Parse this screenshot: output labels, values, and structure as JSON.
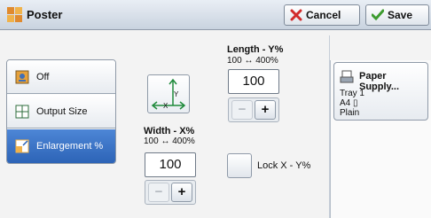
{
  "header": {
    "title": "Poster",
    "cancel_label": "Cancel",
    "save_label": "Save"
  },
  "options": {
    "items": [
      {
        "label": "Off",
        "icon": "off-icon"
      },
      {
        "label": "Output Size",
        "icon": "output-size-icon"
      },
      {
        "label": "Enlargement %",
        "icon": "enlargement-icon"
      }
    ],
    "selected": "Enlargement %"
  },
  "length": {
    "label": "Length - Y%",
    "range": "100 ↔ 400%",
    "value": "100",
    "minus": "−",
    "plus": "+"
  },
  "width": {
    "label": "Width - X%",
    "range": "100 ↔ 400%",
    "value": "100",
    "minus": "−",
    "plus": "+"
  },
  "lock": {
    "label": "Lock X - Y%"
  },
  "paper_supply": {
    "label": "Paper Supply...",
    "tray": "Tray 1",
    "size": "A4 ▯",
    "type": "Plain"
  },
  "colors": {
    "selected": "#2b62b5",
    "cancel_icon": "#d22b2b",
    "save_icon": "#3c9b2e"
  }
}
